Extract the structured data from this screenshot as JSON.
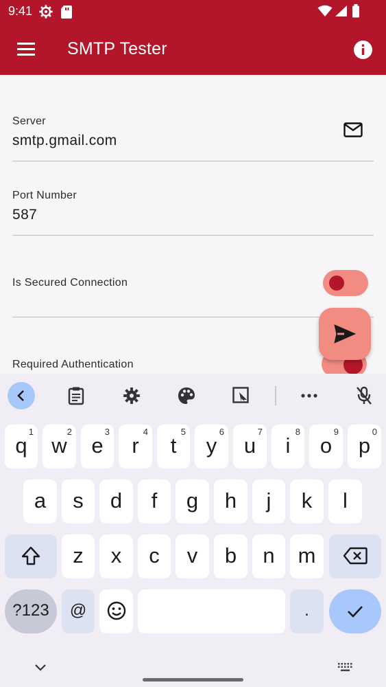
{
  "status_bar": {
    "time": "9:41",
    "icons": [
      "settings-gear-icon",
      "sd-card-icon",
      "wifi-icon",
      "signal-icon",
      "battery-icon"
    ]
  },
  "app_bar": {
    "title": "SMTP Tester",
    "menu_icon": "hamburger-menu-icon",
    "info_icon": "info-icon",
    "color": "#b3162a"
  },
  "form": {
    "server": {
      "label": "Server",
      "value": "smtp.gmail.com",
      "icon": "mail-icon"
    },
    "port": {
      "label": "Port Number",
      "value": "587"
    },
    "secured": {
      "label": "Is Secured Connection",
      "enabled": false
    },
    "auth": {
      "label": "Required Authentication",
      "enabled": true
    },
    "send_fab_icon": "send-icon"
  },
  "keyboard": {
    "toolbar": [
      "back-chevron-icon",
      "clipboard-icon",
      "settings-icon",
      "palette-icon",
      "resize-icon",
      "more-icon",
      "mic-off-icon"
    ],
    "row1": [
      {
        "k": "q",
        "h": "1"
      },
      {
        "k": "w",
        "h": "2"
      },
      {
        "k": "e",
        "h": "3"
      },
      {
        "k": "r",
        "h": "4"
      },
      {
        "k": "t",
        "h": "5"
      },
      {
        "k": "y",
        "h": "6"
      },
      {
        "k": "u",
        "h": "7"
      },
      {
        "k": "i",
        "h": "8"
      },
      {
        "k": "o",
        "h": "9"
      },
      {
        "k": "p",
        "h": "0"
      }
    ],
    "row2": [
      "a",
      "s",
      "d",
      "f",
      "g",
      "h",
      "j",
      "k",
      "l"
    ],
    "row3": [
      "z",
      "x",
      "c",
      "v",
      "b",
      "n",
      "m"
    ],
    "symbols_key": "?123",
    "at_key": "@",
    "period_key": ".",
    "accent_color": "#a8c7fa"
  }
}
